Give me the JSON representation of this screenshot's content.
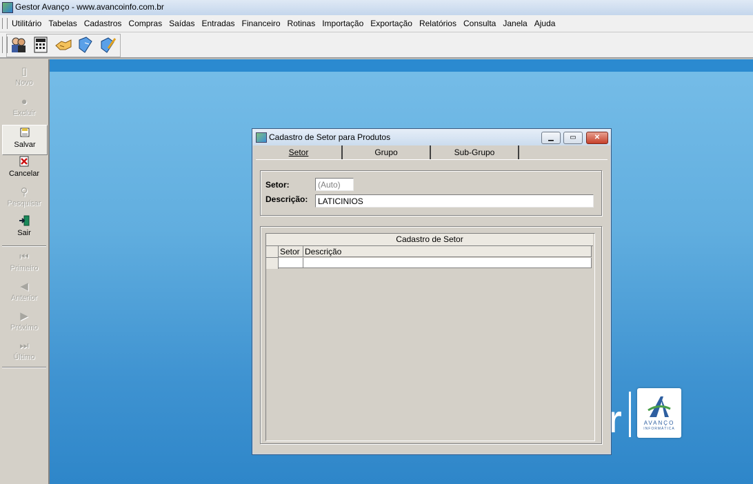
{
  "app": {
    "title": "Gestor Avanço - www.avancoinfo.com.br"
  },
  "menu": [
    "Utilitário",
    "Tabelas",
    "Cadastros",
    "Compras",
    "Saídas",
    "Entradas",
    "Financeiro",
    "Rotinas",
    "Importação",
    "Exportação",
    "Relatórios",
    "Consulta",
    "Janela",
    "Ajuda"
  ],
  "toolbar": {
    "icons": [
      "users-icon",
      "calculator-icon",
      "handshake-icon",
      "book-icon",
      "book-pencil-icon"
    ]
  },
  "sidebar": {
    "buttons": [
      {
        "label": "Novo",
        "icon": "new-document-icon",
        "enabled": false
      },
      {
        "label": "Excluir",
        "icon": "delete-icon",
        "enabled": false
      },
      {
        "label": "Salvar",
        "icon": "save-icon",
        "enabled": true
      },
      {
        "label": "Cancelar",
        "icon": "cancel-icon",
        "enabled": true
      },
      {
        "label": "Pesquisar",
        "icon": "search-icon",
        "enabled": false
      },
      {
        "label": "Sair",
        "icon": "exit-icon",
        "enabled": true
      },
      {
        "label": "Primeiro",
        "icon": "first-icon",
        "enabled": false
      },
      {
        "label": "Anterior",
        "icon": "previous-icon",
        "enabled": false
      },
      {
        "label": "Próximo",
        "icon": "next-icon",
        "enabled": false
      },
      {
        "label": "Último",
        "icon": "last-icon",
        "enabled": false
      }
    ]
  },
  "background": {
    "partial_text": "r",
    "logo_brand": "AVANÇO",
    "logo_sub": "INFORMÁTICA"
  },
  "dialog": {
    "title": "Cadastro de Setor para Produtos",
    "tabs": [
      "Setor",
      "Grupo",
      "Sub-Grupo"
    ],
    "active_tab": "Setor",
    "form": {
      "setor_label": "Setor:",
      "setor_value": "(Auto)",
      "descricao_label": "Descrição:",
      "descricao_value": "LATICINIOS"
    },
    "grid": {
      "caption": "Cadastro de Setor",
      "columns": [
        "Setor",
        "Descrição"
      ],
      "rows": []
    }
  },
  "colors": {
    "desktop_top": "#76bde8",
    "desktop_bottom": "#2e86c9",
    "dialog_face": "#d4d0c8",
    "close_button": "#c6402a"
  }
}
